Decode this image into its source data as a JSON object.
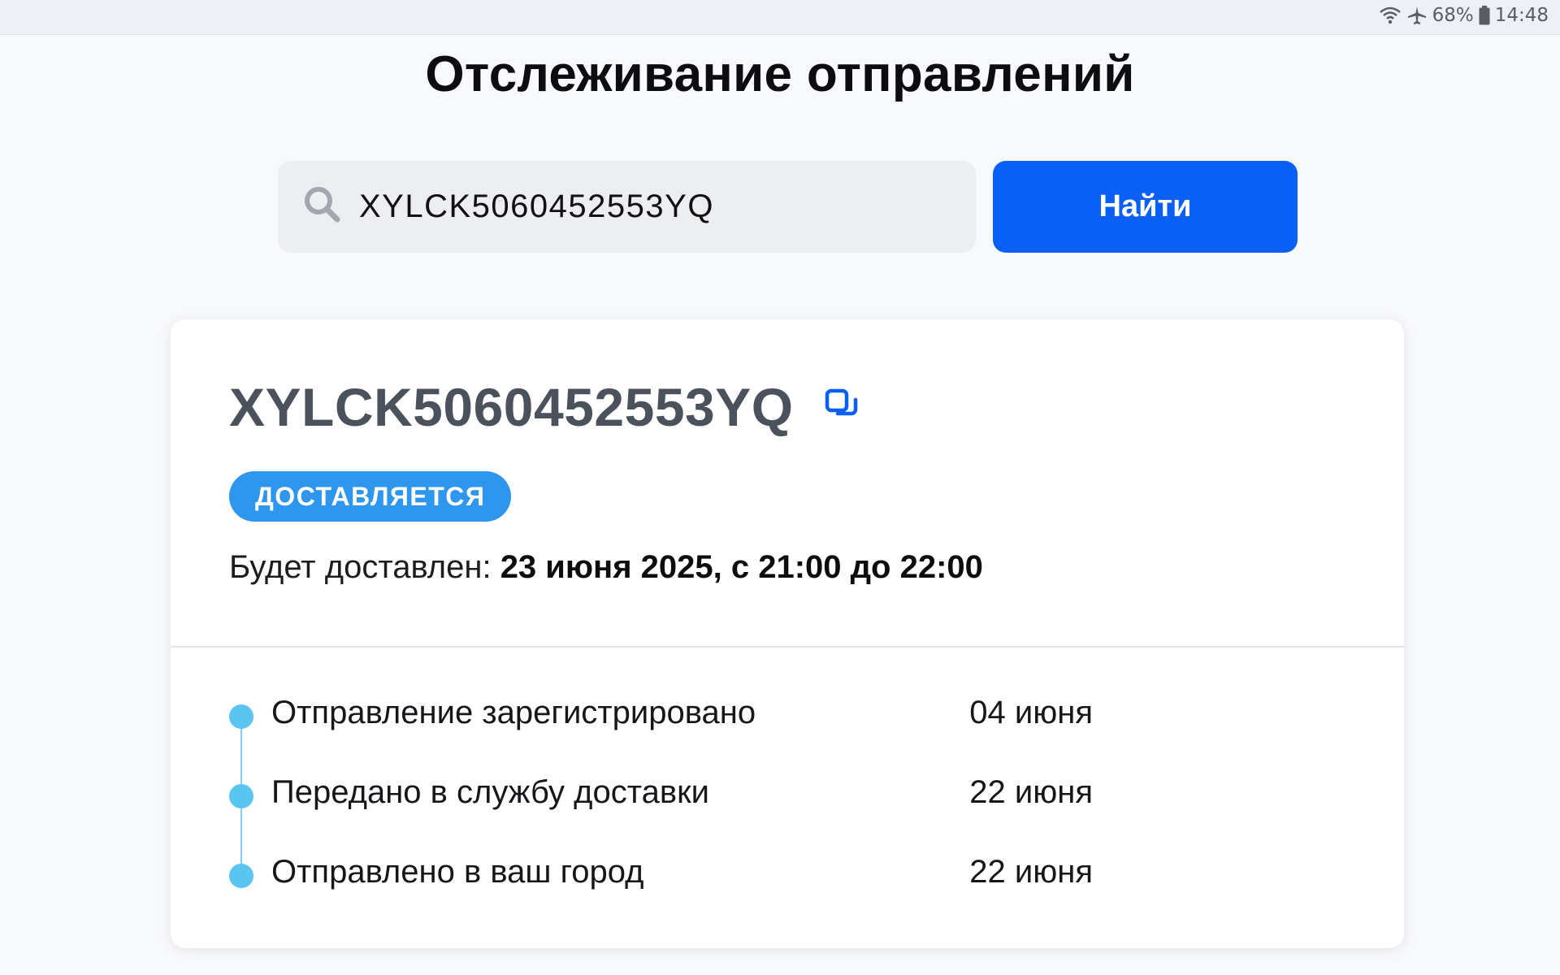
{
  "statusbar": {
    "battery": "68%",
    "time": "14:48",
    "icons": [
      "wifi-icon",
      "airplane-icon",
      "battery-icon"
    ]
  },
  "page": {
    "title": "Отслеживание отправлений"
  },
  "search": {
    "value": "XYLCK5060452553YQ",
    "button_label": "Найти"
  },
  "shipment": {
    "tracking_number": "XYLCK5060452553YQ",
    "status": "ДОСТАВЛЯЕТСЯ",
    "delivery_label": "Будет доставлен:",
    "delivery_value": "23 июня 2025, с 21:00 до 22:00",
    "events": [
      {
        "label": "Отправление зарегистрировано",
        "date": "04 июня"
      },
      {
        "label": "Передано в службу доставки",
        "date": "22 июня"
      },
      {
        "label": "Отправлено в ваш город",
        "date": "22 июня"
      }
    ]
  },
  "colors": {
    "accent": "#0a5ff5",
    "badge": "#2f96ee",
    "timeline_dot": "#5bc5f2"
  }
}
